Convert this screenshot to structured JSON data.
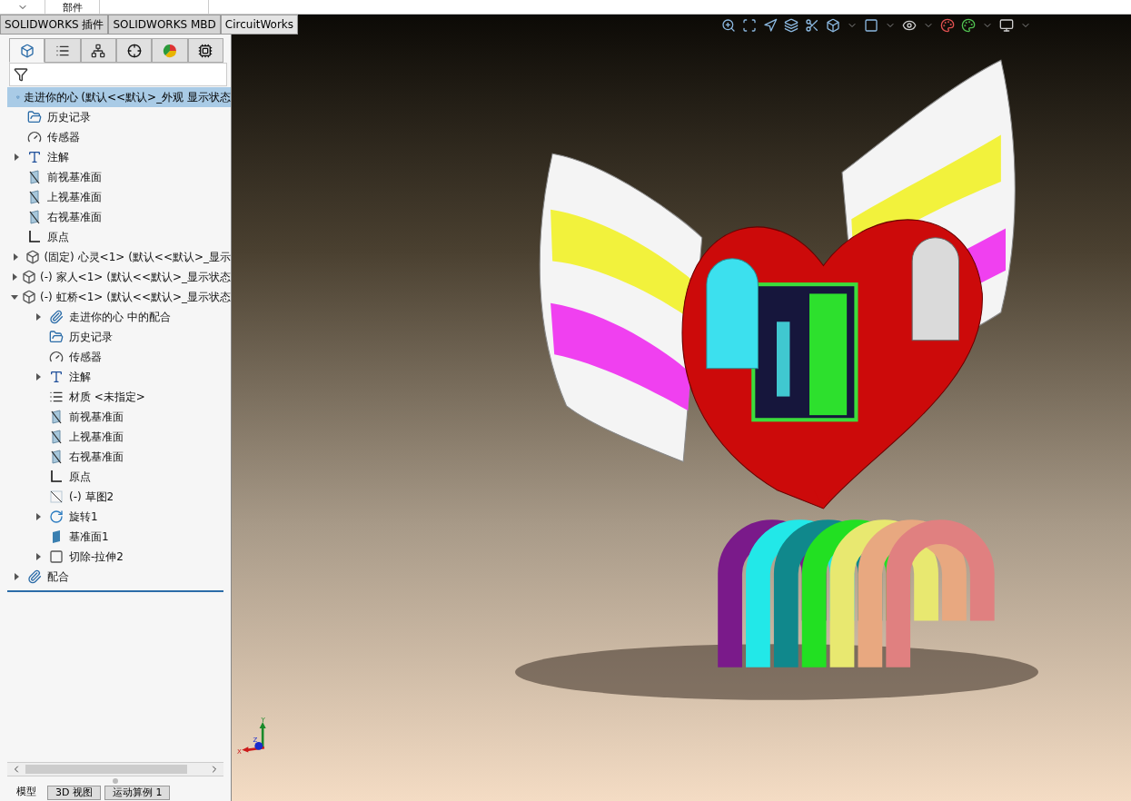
{
  "ribbon": {
    "labels": [
      "部件"
    ]
  },
  "command_tabs": [
    {
      "label": "SOLIDWORKS 插件",
      "selected": false
    },
    {
      "label": "SOLIDWORKS MBD",
      "selected": false
    },
    {
      "label": "CircuitWorks",
      "selected": true
    }
  ],
  "manager_tabs": [
    {
      "kind": "feature",
      "selected": true
    },
    {
      "kind": "property",
      "selected": false
    },
    {
      "kind": "config",
      "selected": false
    },
    {
      "kind": "dimxpert",
      "selected": false
    },
    {
      "kind": "display",
      "selected": false
    },
    {
      "kind": "chip",
      "selected": false
    }
  ],
  "feature_tree": {
    "root": {
      "label": "走进你的心  (默认<<默认>_外观 显示状态",
      "selected": true
    },
    "items": [
      {
        "kind": "history",
        "label": "历史记录"
      },
      {
        "kind": "sensor",
        "label": "传感器"
      },
      {
        "kind": "annotation",
        "label": "注解",
        "expanded": false
      },
      {
        "kind": "plane",
        "label": "前视基准面"
      },
      {
        "kind": "plane",
        "label": "上视基准面"
      },
      {
        "kind": "plane",
        "label": "右视基准面"
      },
      {
        "kind": "origin",
        "label": "原点"
      },
      {
        "kind": "part",
        "label": "(固定) 心灵<1> (默认<<默认>_显示",
        "expanded": false
      },
      {
        "kind": "part",
        "label": "(-) 家人<1> (默认<<默认>_显示状态",
        "expanded": false
      },
      {
        "kind": "part",
        "label": "(-) 虹桥<1> (默认<<默认>_显示状态",
        "expanded": true,
        "children": [
          {
            "kind": "mates-folder",
            "label": "走进你的心 中的配合",
            "expanded": false
          },
          {
            "kind": "history",
            "label": "历史记录"
          },
          {
            "kind": "sensor",
            "label": "传感器"
          },
          {
            "kind": "annotation",
            "label": "注解",
            "expanded": false
          },
          {
            "kind": "material",
            "label": "材质 <未指定>"
          },
          {
            "kind": "plane",
            "label": "前视基准面"
          },
          {
            "kind": "plane",
            "label": "上视基准面"
          },
          {
            "kind": "plane",
            "label": "右视基准面"
          },
          {
            "kind": "origin",
            "label": "原点"
          },
          {
            "kind": "sketch",
            "label": "(-) 草图2"
          },
          {
            "kind": "revolve",
            "label": "旋转1",
            "expanded": false
          },
          {
            "kind": "refplane",
            "label": "基准面1"
          },
          {
            "kind": "cut",
            "label": "切除-拉伸2",
            "expanded": false
          }
        ]
      },
      {
        "kind": "mates",
        "label": "配合",
        "expanded": false
      }
    ]
  },
  "bottom_tabs": [
    {
      "label": "模型",
      "selected": true
    },
    {
      "label": "3D 视图",
      "selected": false
    },
    {
      "label": "运动算例 1",
      "selected": false
    }
  ],
  "triad": {
    "x": "X",
    "y": "Y",
    "z": "Z"
  }
}
